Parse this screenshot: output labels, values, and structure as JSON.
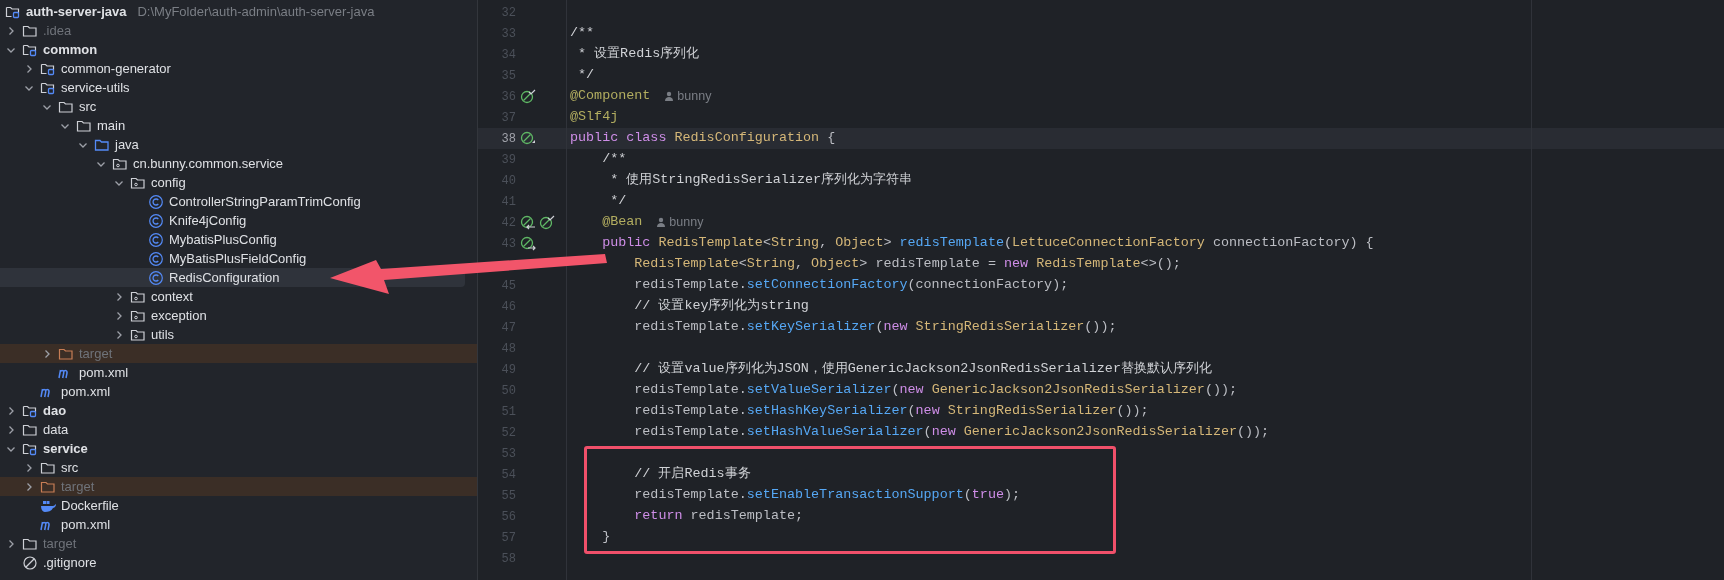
{
  "project_tree": {
    "items": [
      {
        "label": "auth-server-java",
        "path": "D:\\MyFolder\\auth-admin\\auth-server-java",
        "kind": "module",
        "selected": false,
        "excluded": false,
        "dim": false,
        "children": [
          {
            "label": ".idea",
            "kind": "folder",
            "expanded": false,
            "selected": false,
            "excluded": false,
            "dim": true
          },
          {
            "label": "common",
            "kind": "module",
            "expanded": true,
            "selected": false,
            "excluded": false,
            "dim": false,
            "children": [
              {
                "label": "common-generator",
                "kind": "module",
                "expanded": false,
                "selected": false,
                "excluded": false,
                "dim": false
              },
              {
                "label": "service-utils",
                "kind": "module",
                "expanded": true,
                "selected": false,
                "excluded": false,
                "dim": false,
                "children": [
                  {
                    "label": "src",
                    "kind": "folder",
                    "expanded": true,
                    "selected": false,
                    "excluded": false,
                    "dim": false,
                    "children": [
                      {
                        "label": "main",
                        "kind": "folder",
                        "expanded": true,
                        "selected": false,
                        "excluded": false,
                        "dim": false,
                        "children": [
                          {
                            "label": "java",
                            "kind": "source",
                            "expanded": true,
                            "selected": false,
                            "excluded": false,
                            "dim": false,
                            "children": [
                              {
                                "label": "cn.bunny.common.service",
                                "kind": "package",
                                "expanded": true,
                                "selected": false,
                                "excluded": false,
                                "dim": false,
                                "children": [
                                  {
                                    "label": "config",
                                    "kind": "package",
                                    "expanded": true,
                                    "selected": false,
                                    "excluded": false,
                                    "dim": false,
                                    "children": [
                                      {
                                        "label": "ControllerStringParamTrimConfig",
                                        "kind": "class",
                                        "selected": false,
                                        "excluded": false,
                                        "dim": false
                                      },
                                      {
                                        "label": "Knife4jConfig",
                                        "kind": "class",
                                        "selected": false,
                                        "excluded": false,
                                        "dim": false
                                      },
                                      {
                                        "label": "MybatisPlusConfig",
                                        "kind": "class",
                                        "selected": false,
                                        "excluded": false,
                                        "dim": false
                                      },
                                      {
                                        "label": "MyBatisPlusFieldConfig",
                                        "kind": "class",
                                        "selected": false,
                                        "excluded": false,
                                        "dim": false
                                      },
                                      {
                                        "label": "RedisConfiguration",
                                        "kind": "class",
                                        "selected": true,
                                        "excluded": false,
                                        "dim": false
                                      }
                                    ]
                                  },
                                  {
                                    "label": "context",
                                    "kind": "package",
                                    "expanded": false,
                                    "selected": false,
                                    "excluded": false,
                                    "dim": false
                                  },
                                  {
                                    "label": "exception",
                                    "kind": "package",
                                    "expanded": false,
                                    "selected": false,
                                    "excluded": false,
                                    "dim": false
                                  },
                                  {
                                    "label": "utils",
                                    "kind": "package",
                                    "expanded": false,
                                    "selected": false,
                                    "excluded": false,
                                    "dim": false
                                  }
                                ]
                              }
                            ]
                          }
                        ]
                      }
                    ]
                  },
                  {
                    "label": "target",
                    "kind": "folder",
                    "expanded": false,
                    "selected": false,
                    "excluded": true,
                    "dim": true
                  },
                  {
                    "label": "pom.xml",
                    "kind": "maven",
                    "selected": false,
                    "excluded": false,
                    "dim": false
                  }
                ]
              },
              {
                "label": "pom.xml",
                "kind": "maven",
                "selected": false,
                "excluded": false,
                "dim": false
              }
            ]
          },
          {
            "label": "dao",
            "kind": "module",
            "expanded": false,
            "selected": false,
            "excluded": false,
            "dim": false
          },
          {
            "label": "data",
            "kind": "folder",
            "expanded": false,
            "selected": false,
            "excluded": false,
            "dim": false
          },
          {
            "label": "service",
            "kind": "module",
            "expanded": true,
            "selected": false,
            "excluded": false,
            "dim": false,
            "children": [
              {
                "label": "src",
                "kind": "folder",
                "expanded": false,
                "selected": false,
                "excluded": false,
                "dim": false
              },
              {
                "label": "target",
                "kind": "folder",
                "expanded": false,
                "selected": false,
                "excluded": true,
                "dim": true
              },
              {
                "label": "Dockerfile",
                "kind": "docker",
                "selected": false,
                "excluded": false,
                "dim": false
              },
              {
                "label": "pom.xml",
                "kind": "maven",
                "selected": false,
                "excluded": false,
                "dim": false
              }
            ]
          },
          {
            "label": "target",
            "kind": "folder",
            "expanded": false,
            "selected": false,
            "excluded": false,
            "dim": true
          },
          {
            "label": ".gitignore",
            "kind": "ignore",
            "selected": false,
            "excluded": false,
            "dim": false
          }
        ]
      }
    ]
  },
  "editor": {
    "lines": [
      {
        "number": "32",
        "current": false
      },
      {
        "number": "33",
        "current": false,
        "tokens": [
          {
            "kind": "comment",
            "text": "/**"
          }
        ]
      },
      {
        "number": "34",
        "current": false,
        "tokens": [
          {
            "kind": "comment",
            "text": " * 设置Redis序列化"
          }
        ]
      },
      {
        "number": "35",
        "current": false,
        "tokens": [
          {
            "kind": "comment",
            "text": " */"
          }
        ]
      },
      {
        "number": "36",
        "current": false,
        "markers": [
          {
            "kind": "bean-check"
          }
        ],
        "tokens": [
          {
            "kind": "annotation",
            "text": "@Component"
          },
          {
            "kind": "author",
            "text": "bunny"
          }
        ]
      },
      {
        "number": "37",
        "current": false,
        "tokens": [
          {
            "kind": "annotation",
            "text": "@Slf4j"
          }
        ]
      },
      {
        "number": "38",
        "current": true,
        "markers": [
          {
            "kind": "bean"
          }
        ],
        "tokens": [
          {
            "kind": "keyword",
            "text": "public class "
          },
          {
            "kind": "type",
            "text": "RedisConfiguration"
          },
          {
            "kind": "plain",
            "text": " {"
          }
        ]
      },
      {
        "number": "39",
        "current": false,
        "tokens": [
          {
            "kind": "comment",
            "text": "    /**"
          }
        ]
      },
      {
        "number": "40",
        "current": false,
        "tokens": [
          {
            "kind": "comment",
            "text": "     * 使用StringRedisSerializer序列化为字符串"
          }
        ]
      },
      {
        "number": "41",
        "current": false,
        "tokens": [
          {
            "kind": "comment",
            "text": "     */"
          }
        ]
      },
      {
        "number": "42",
        "current": false,
        "markers": [
          {
            "kind": "bean-in"
          },
          {
            "kind": "bean-check"
          }
        ],
        "tokens": [
          {
            "kind": "annotation",
            "text": "    @Bean"
          },
          {
            "kind": "author",
            "text": "bunny"
          }
        ]
      },
      {
        "number": "43",
        "current": false,
        "markers": [
          {
            "kind": "bean-out"
          }
        ],
        "tokens": [
          {
            "kind": "keyword",
            "text": "    public "
          },
          {
            "kind": "type",
            "text": "RedisTemplate"
          },
          {
            "kind": "plain",
            "text": "<"
          },
          {
            "kind": "type",
            "text": "String"
          },
          {
            "kind": "plain",
            "text": ", "
          },
          {
            "kind": "type",
            "text": "Object"
          },
          {
            "kind": "plain",
            "text": "> "
          },
          {
            "kind": "method",
            "text": "redisTemplate"
          },
          {
            "kind": "plain",
            "text": "("
          },
          {
            "kind": "type",
            "text": "LettuceConnectionFactory"
          },
          {
            "kind": "plain",
            "text": " connectionFactory) {"
          }
        ]
      },
      {
        "current": false,
        "tokens": [
          {
            "kind": "type",
            "text": "        RedisTemplate"
          },
          {
            "kind": "plain",
            "text": "<"
          },
          {
            "kind": "type",
            "text": "String"
          },
          {
            "kind": "plain",
            "text": ", "
          },
          {
            "kind": "type",
            "text": "Object"
          },
          {
            "kind": "plain",
            "text": "> redisTemplate = "
          },
          {
            "kind": "keyword",
            "text": "new "
          },
          {
            "kind": "type",
            "text": "RedisTemplate"
          },
          {
            "kind": "plain",
            "text": "<>();"
          }
        ]
      },
      {
        "number": "45",
        "current": false,
        "tokens": [
          {
            "kind": "plain",
            "text": "        redisTemplate."
          },
          {
            "kind": "method",
            "text": "setConnectionFactory"
          },
          {
            "kind": "plain",
            "text": "(connectionFactory);"
          }
        ]
      },
      {
        "number": "46",
        "current": false,
        "tokens": [
          {
            "kind": "comment",
            "text": "        // 设置key序列化为string"
          }
        ]
      },
      {
        "number": "47",
        "current": false,
        "tokens": [
          {
            "kind": "plain",
            "text": "        redisTemplate."
          },
          {
            "kind": "method",
            "text": "setKeySerializer"
          },
          {
            "kind": "plain",
            "text": "("
          },
          {
            "kind": "keyword",
            "text": "new "
          },
          {
            "kind": "type",
            "text": "StringRedisSerializer"
          },
          {
            "kind": "plain",
            "text": "());"
          }
        ]
      },
      {
        "number": "48",
        "current": false
      },
      {
        "number": "49",
        "current": false,
        "tokens": [
          {
            "kind": "comment",
            "text": "        // 设置value序列化为JSON，使用GenericJackson2JsonRedisSerializer替换默认序列化"
          }
        ]
      },
      {
        "number": "50",
        "current": false,
        "tokens": [
          {
            "kind": "plain",
            "text": "        redisTemplate."
          },
          {
            "kind": "method",
            "text": "setValueSerializer"
          },
          {
            "kind": "plain",
            "text": "("
          },
          {
            "kind": "keyword",
            "text": "new "
          },
          {
            "kind": "type",
            "text": "GenericJackson2JsonRedisSerializer"
          },
          {
            "kind": "plain",
            "text": "());"
          }
        ]
      },
      {
        "number": "51",
        "current": false,
        "tokens": [
          {
            "kind": "plain",
            "text": "        redisTemplate."
          },
          {
            "kind": "method",
            "text": "setHashKeySerializer"
          },
          {
            "kind": "plain",
            "text": "("
          },
          {
            "kind": "keyword",
            "text": "new "
          },
          {
            "kind": "type",
            "text": "StringRedisSerializer"
          },
          {
            "kind": "plain",
            "text": "());"
          }
        ]
      },
      {
        "number": "52",
        "current": false,
        "tokens": [
          {
            "kind": "plain",
            "text": "        redisTemplate."
          },
          {
            "kind": "method",
            "text": "setHashValueSerializer"
          },
          {
            "kind": "plain",
            "text": "("
          },
          {
            "kind": "keyword",
            "text": "new "
          },
          {
            "kind": "type",
            "text": "GenericJackson2JsonRedisSerializer"
          },
          {
            "kind": "plain",
            "text": "());"
          }
        ]
      },
      {
        "number": "53",
        "current": false
      },
      {
        "number": "54",
        "current": false,
        "tokens": [
          {
            "kind": "comment",
            "text": "        // 开启Redis事务"
          }
        ]
      },
      {
        "number": "55",
        "current": false,
        "tokens": [
          {
            "kind": "plain",
            "text": "        redisTemplate."
          },
          {
            "kind": "method",
            "text": "setEnableTransactionSupport"
          },
          {
            "kind": "plain",
            "text": "("
          },
          {
            "kind": "keyword",
            "text": "true"
          },
          {
            "kind": "plain",
            "text": ");"
          }
        ]
      },
      {
        "number": "56",
        "current": false,
        "tokens": [
          {
            "kind": "keyword",
            "text": "        return "
          },
          {
            "kind": "plain",
            "text": "redisTemplate;"
          }
        ]
      },
      {
        "number": "57",
        "current": false,
        "tokens": [
          {
            "kind": "plain",
            "text": "    }"
          }
        ]
      },
      {
        "number": "58",
        "current": false
      }
    ]
  }
}
